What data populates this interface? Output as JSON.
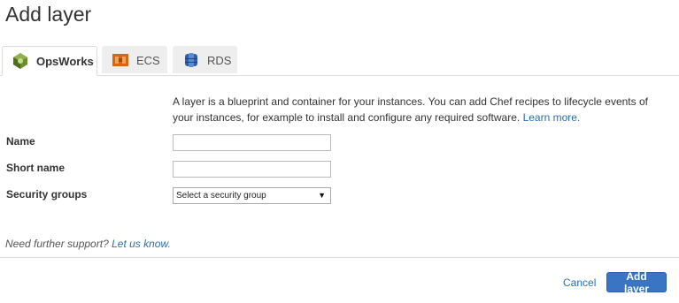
{
  "page": {
    "title": "Add layer"
  },
  "tabs": [
    {
      "label": "OpsWorks",
      "icon": "opsworks-icon",
      "active": true
    },
    {
      "label": "ECS",
      "icon": "ecs-icon",
      "active": false
    },
    {
      "label": "RDS",
      "icon": "rds-icon",
      "active": false
    }
  ],
  "description": {
    "text": "A layer is a blueprint and container for your instances. You can add Chef recipes to lifecycle events of your instances, for example to install and configure any required software.",
    "link_label": "Learn more."
  },
  "form": {
    "name_label": "Name",
    "name_value": "",
    "short_name_label": "Short name",
    "short_name_value": "",
    "security_groups_label": "Security groups",
    "security_groups_selected": "Select a security group"
  },
  "support": {
    "text": "Need further support?",
    "link_label": "Let us know."
  },
  "footer": {
    "cancel_label": "Cancel",
    "submit_label": "Add layer"
  },
  "colors": {
    "link": "#2a6db5",
    "primary_button": "#3a75c4",
    "opsworks_icon": "#6b8e2f",
    "ecs_icon": "#d86613",
    "rds_icon": "#2e5fa8"
  }
}
